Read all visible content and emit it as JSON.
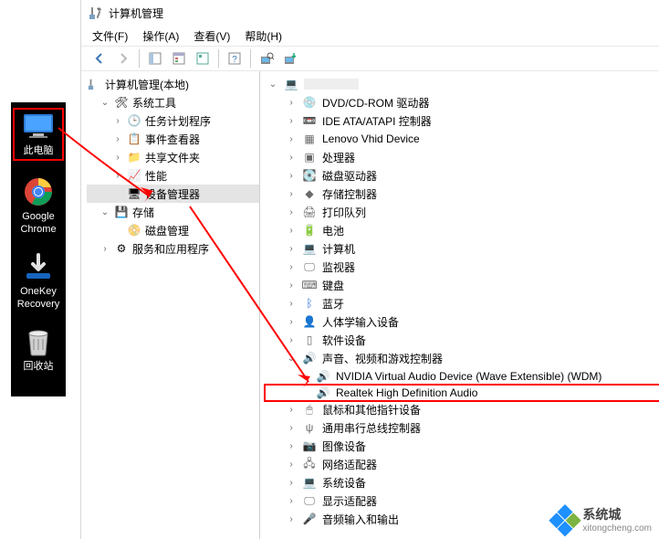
{
  "desktop_icons": [
    {
      "name": "this-pc",
      "label": "此电脑",
      "highlight": true
    },
    {
      "name": "chrome",
      "label": "Google\nChrome"
    },
    {
      "name": "onekey",
      "label": "OneKey\nRecovery"
    },
    {
      "name": "recycle",
      "label": "回收站"
    }
  ],
  "window": {
    "title": "计算机管理"
  },
  "menubar": {
    "file": "文件(F)",
    "action": "操作(A)",
    "view": "查看(V)",
    "help": "帮助(H)"
  },
  "left_tree": {
    "root": "计算机管理(本地)",
    "system_tools": "系统工具",
    "task_scheduler": "任务计划程序",
    "event_viewer": "事件查看器",
    "shared_folders": "共享文件夹",
    "performance": "性能",
    "device_manager": "设备管理器",
    "storage": "存储",
    "disk_management": "磁盘管理",
    "services_apps": "服务和应用程序"
  },
  "device_tree": {
    "dvd": "DVD/CD-ROM 驱动器",
    "ide": "IDE ATA/ATAPI 控制器",
    "lenovo": "Lenovo Vhid Device",
    "cpu": "处理器",
    "disk_drives": "磁盘驱动器",
    "storage_ctrl": "存储控制器",
    "print_queue": "打印队列",
    "battery": "电池",
    "computer": "计算机",
    "monitor": "监视器",
    "keyboard": "键盘",
    "bluetooth": "蓝牙",
    "hid": "人体学输入设备",
    "software_dev": "软件设备",
    "sound": "声音、视频和游戏控制器",
    "nvidia_audio": "NVIDIA Virtual Audio Device (Wave Extensible) (WDM)",
    "realtek": "Realtek High Definition Audio",
    "mouse": "鼠标和其他指针设备",
    "usb_ctrl": "通用串行总线控制器",
    "imaging": "图像设备",
    "network": "网络适配器",
    "system_dev": "系统设备",
    "display": "显示适配器",
    "audio_io": "音频输入和输出"
  },
  "watermark": {
    "text": "系统城",
    "url": "xitongcheng.com"
  },
  "colors": {
    "highlight_red": "#ff0000",
    "wm_blue": "#1e90ff",
    "wm_green": "#7cb342"
  }
}
